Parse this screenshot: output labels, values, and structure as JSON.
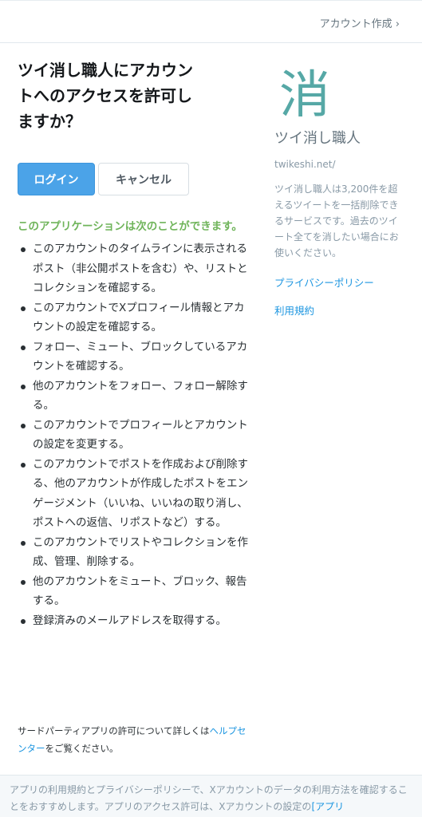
{
  "header": {
    "signup_link": "アカウント作成 ›"
  },
  "main": {
    "title_lines": [
      "ツイ消し職人にアカウン",
      "トへのアクセスを許可し",
      "ますか？"
    ],
    "login_button": "ログイン",
    "cancel_button": "キャンセル",
    "permissions_heading": "このアプリケーションは次のことができます。",
    "permissions": [
      "このアカウントのタイムラインに表示されるポスト（非公開ポストを含む）や、リストとコレクションを確認する。",
      "このアカウントでXプロフィール情報とアカウントの設定を確認する。",
      "フォロー、ミュート、ブロックしているアカウントを確認する。",
      "他のアカウントをフォロー、フォロー解除する。",
      "このアカウントでプロフィールとアカウントの設定を変更する。",
      "このアカウントでポストを作成および削除する、他のアカウントが作成したポストをエンゲージメント（いいね、いいねの取り消し、ポストへの返信、リポストなど）する。",
      "このアカウントでリストやコレクションを作成、管理、削除する。",
      "他のアカウントをミュート、ブロック、報告する。",
      "登録済みのメールアドレスを取得する。"
    ],
    "thirdparty_prefix": "サードパーティアプリの許可について詳しくは",
    "help_center_link": "ヘルプセンター",
    "thirdparty_suffix": "をご覧ください。"
  },
  "app": {
    "logo_char": "消",
    "logo_color": "#56a8a6",
    "name": "ツイ消し職人",
    "url": "twikeshi.net/",
    "description": "ツイ消し職人は3,200件を超えるツイートを一括削除できるサービスです。過去のツイート全てを消したい場合にお使いください。",
    "privacy_link": "プライバシーポリシー",
    "terms_link": "利用規約"
  },
  "footer": {
    "text": "アプリの利用規約とプライバシーポリシーで、Xアカウントのデータの利用方法を確認することをおすすめします。アプリのアクセス許可は、Xアカウントの設定の",
    "link": "[アプリ"
  },
  "colors": {
    "accent": "#1b95e0",
    "login_button": "#4ba3e8",
    "permission_heading": "#6fb45a"
  }
}
